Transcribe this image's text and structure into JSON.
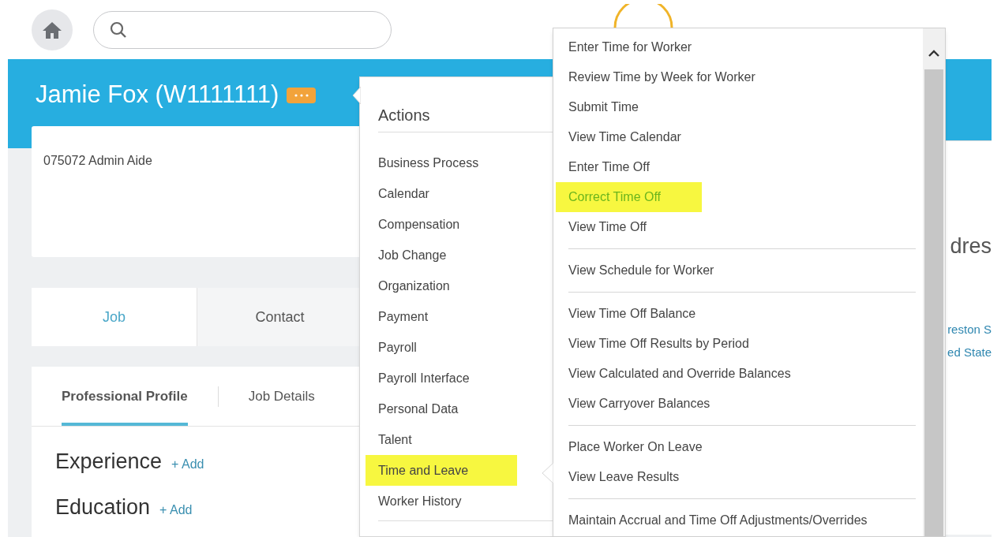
{
  "header": {
    "title": "Jamie Fox (W1111111)"
  },
  "card": {
    "position": "075072 Admin Aide"
  },
  "tabs": [
    {
      "label": "Job",
      "selected": true
    },
    {
      "label": "Contact",
      "selected": false
    }
  ],
  "subtabs": [
    {
      "label": "Professional Profile",
      "selected": true
    },
    {
      "label": "Job Details",
      "selected": false
    }
  ],
  "sections": [
    {
      "title": "Experience",
      "action": "+ Add"
    },
    {
      "title": "Education",
      "action": "+ Add"
    }
  ],
  "right_panel": {
    "heading": "dres",
    "links": [
      "reston S",
      "ed State"
    ]
  },
  "actions_menu": {
    "title": "Actions",
    "items": [
      {
        "label": "Business Process",
        "highlighted": false
      },
      {
        "label": "Calendar",
        "highlighted": false
      },
      {
        "label": "Compensation",
        "highlighted": false
      },
      {
        "label": "Job Change",
        "highlighted": false
      },
      {
        "label": "Organization",
        "highlighted": false
      },
      {
        "label": "Payment",
        "highlighted": false
      },
      {
        "label": "Payroll",
        "highlighted": false
      },
      {
        "label": "Payroll Interface",
        "highlighted": false
      },
      {
        "label": "Personal Data",
        "highlighted": false
      },
      {
        "label": "Talent",
        "highlighted": false
      },
      {
        "label": "Time and Leave",
        "highlighted": true
      },
      {
        "label": "Worker History",
        "highlighted": false
      }
    ]
  },
  "submenu": {
    "groups": [
      {
        "items": [
          {
            "label": "Enter Time for Worker",
            "highlighted": false
          },
          {
            "label": "Review Time by Week for Worker",
            "highlighted": false
          },
          {
            "label": "Submit Time",
            "highlighted": false
          },
          {
            "label": "View Time Calendar",
            "highlighted": false
          },
          {
            "label": "Enter Time Off",
            "highlighted": false
          },
          {
            "label": "Correct Time Off",
            "highlighted": true
          },
          {
            "label": "View Time Off",
            "highlighted": false
          }
        ]
      },
      {
        "items": [
          {
            "label": "View Schedule for Worker",
            "highlighted": false
          }
        ]
      },
      {
        "items": [
          {
            "label": "View Time Off Balance",
            "highlighted": false
          },
          {
            "label": "View Time Off Results by Period",
            "highlighted": false
          },
          {
            "label": "View Calculated and Override Balances",
            "highlighted": false
          },
          {
            "label": "View Carryover Balances",
            "highlighted": false
          }
        ]
      },
      {
        "items": [
          {
            "label": "Place Worker On Leave",
            "highlighted": false
          },
          {
            "label": "View Leave Results",
            "highlighted": false
          }
        ]
      },
      {
        "items": [
          {
            "label": "Maintain Accrual and Time Off Adjustments/Overrides",
            "highlighted": false
          }
        ]
      }
    ]
  }
}
